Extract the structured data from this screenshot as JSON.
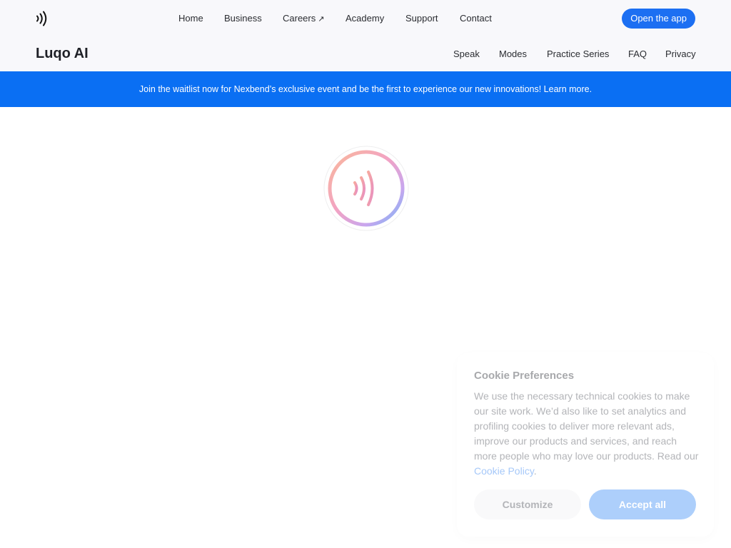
{
  "header": {
    "nav": [
      {
        "label": "Home"
      },
      {
        "label": "Business"
      },
      {
        "label": "Careers"
      },
      {
        "label": "Academy"
      },
      {
        "label": "Support"
      },
      {
        "label": "Contact"
      }
    ],
    "careers_external_icon": "↗",
    "cta_label": "Open the app",
    "brand": "Luqo AI",
    "subnav": [
      {
        "label": "Speak"
      },
      {
        "label": "Modes"
      },
      {
        "label": "Practice Series"
      },
      {
        "label": "FAQ"
      },
      {
        "label": "Privacy"
      }
    ]
  },
  "banner": {
    "text": "Join the waitlist now for Nexbend’s exclusive event and be the first to experience our new innovations! Learn more."
  },
  "loader": {
    "icon": "sound-waves-icon"
  },
  "cookie": {
    "title": "Cookie Preferences",
    "body": "We use the necessary technical cookies to make our site work. We’d also like to set analytics and profiling cookies to deliver more relevant ads, improve our products and services, and reach more people who may love our products. Read our",
    "link_label": "Cookie Policy",
    "body_end": ".",
    "customize_label": "Customize",
    "accept_label": "Accept all"
  },
  "colors": {
    "accent": "#1c6ff2",
    "banner": "#0a6ff3",
    "header_bg": "#f8f8fb"
  }
}
